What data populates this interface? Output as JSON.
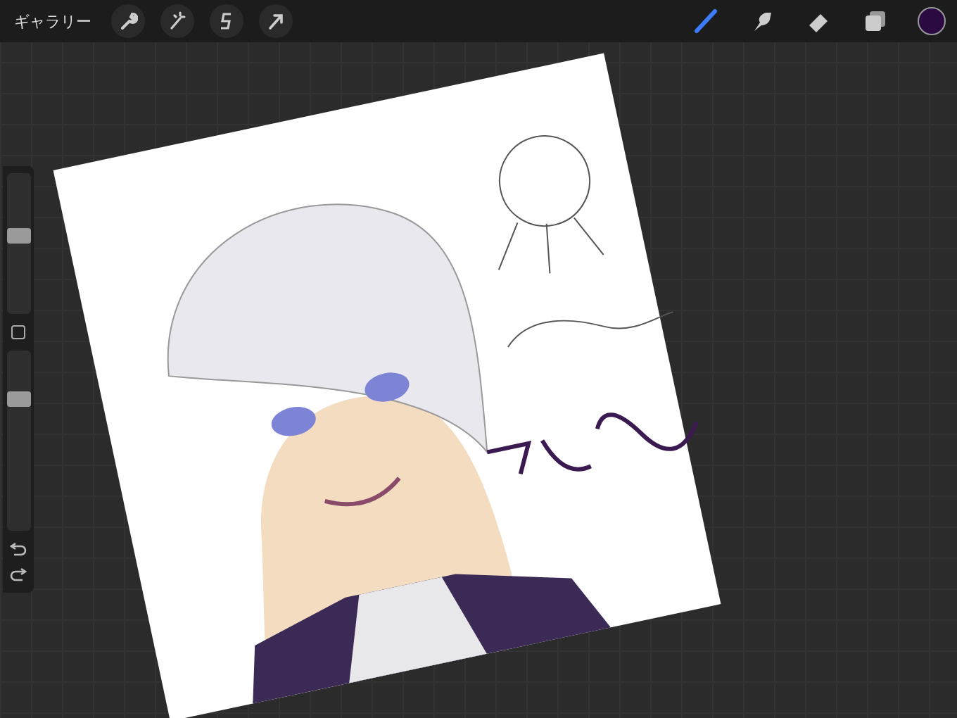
{
  "top_bar": {
    "gallery_label": "ギャラリー",
    "actions": [
      {
        "kind": "wrench"
      },
      {
        "kind": "wand"
      },
      {
        "kind": "selection"
      },
      {
        "kind": "transform"
      }
    ],
    "tools": [
      {
        "kind": "brush",
        "selected": true
      },
      {
        "kind": "smudge",
        "selected": false
      },
      {
        "kind": "eraser",
        "selected": false
      },
      {
        "kind": "layers",
        "selected": false
      }
    ],
    "color": "#2a0a40"
  },
  "sidebar": {
    "size_slider": {
      "level": 0.56
    },
    "opacity_slider": {
      "level": 0.75
    }
  }
}
